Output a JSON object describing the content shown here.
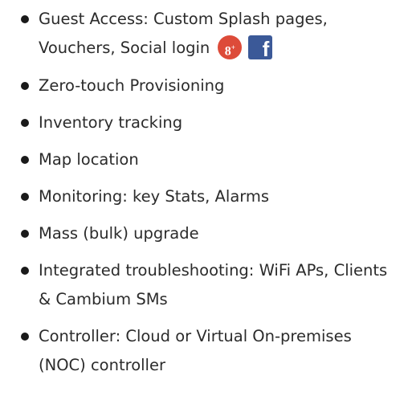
{
  "features": [
    {
      "text": "Guest Access: Custom Splash pages, Vouchers, Social login"
    },
    {
      "text": "Zero-touch Provisioning"
    },
    {
      "text": "Inventory tracking"
    },
    {
      "text": "Map location"
    },
    {
      "text": "Monitoring: key Stats, Alarms"
    },
    {
      "text": "Mass (bulk) upgrade"
    },
    {
      "text": "Integrated troubleshooting: WiFi APs, Clients & Cambium SMs"
    },
    {
      "text": "Controller: Cloud or Virtual On-premises (NOC) controller"
    }
  ],
  "social_icons": {
    "gplus_icon": "google-plus-icon",
    "gplus_label": "8",
    "gplus_sup": "+",
    "facebook_icon": "facebook-icon",
    "facebook_label": "f",
    "gplus_color": "#dd4b39",
    "facebook_color": "#3b5998"
  }
}
